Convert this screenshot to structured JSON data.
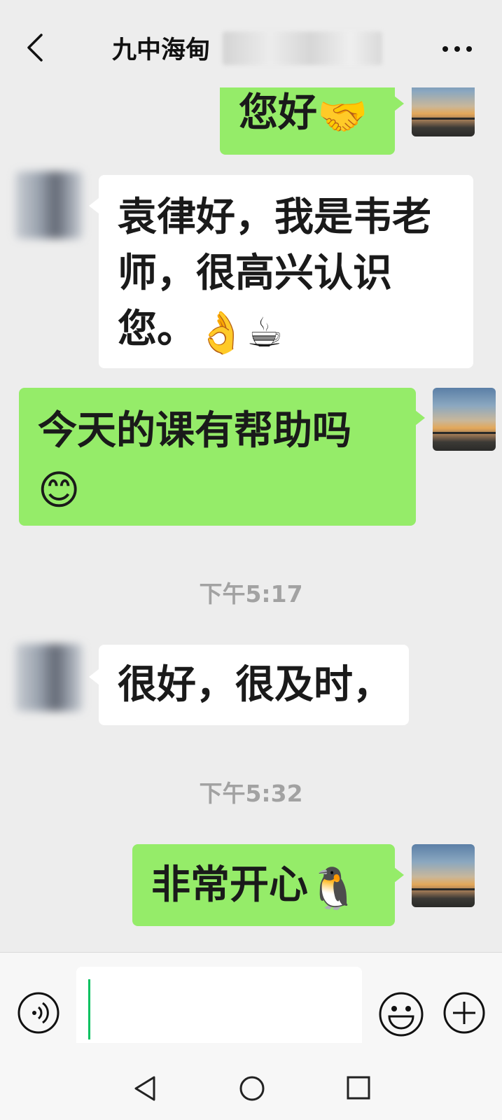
{
  "header": {
    "title": "九中海甸",
    "back_icon": "chevron-left-icon",
    "more_icon": "more-dots-icon"
  },
  "messages": [
    {
      "side": "self",
      "text": "您好",
      "emoji": "🤝"
    },
    {
      "side": "other",
      "lines": [
        "袁律好，我是韦老",
        "师，很高兴认识",
        "您。"
      ],
      "emoji": "👌☕"
    },
    {
      "side": "self",
      "lines": [
        "今天的课有帮助吗"
      ],
      "emoji": "😊"
    },
    {
      "side": "other",
      "text": "很好，很及时，"
    },
    {
      "side": "self",
      "text": "非常开心",
      "emoji": "🐧"
    }
  ],
  "timestamps": [
    "下午5:17",
    "下午5:32"
  ],
  "input": {
    "value": "",
    "voice_icon": "voice-icon",
    "emoji_icon": "smiley-icon",
    "plus_icon": "plus-circle-icon"
  },
  "navbar": {
    "back_icon": "nav-back-icon",
    "home_icon": "nav-home-icon",
    "recent_icon": "nav-recent-icon"
  },
  "colors": {
    "bubble_self": "#95ec69",
    "bubble_other": "#ffffff",
    "background": "#ededed",
    "cursor": "#07c160"
  }
}
